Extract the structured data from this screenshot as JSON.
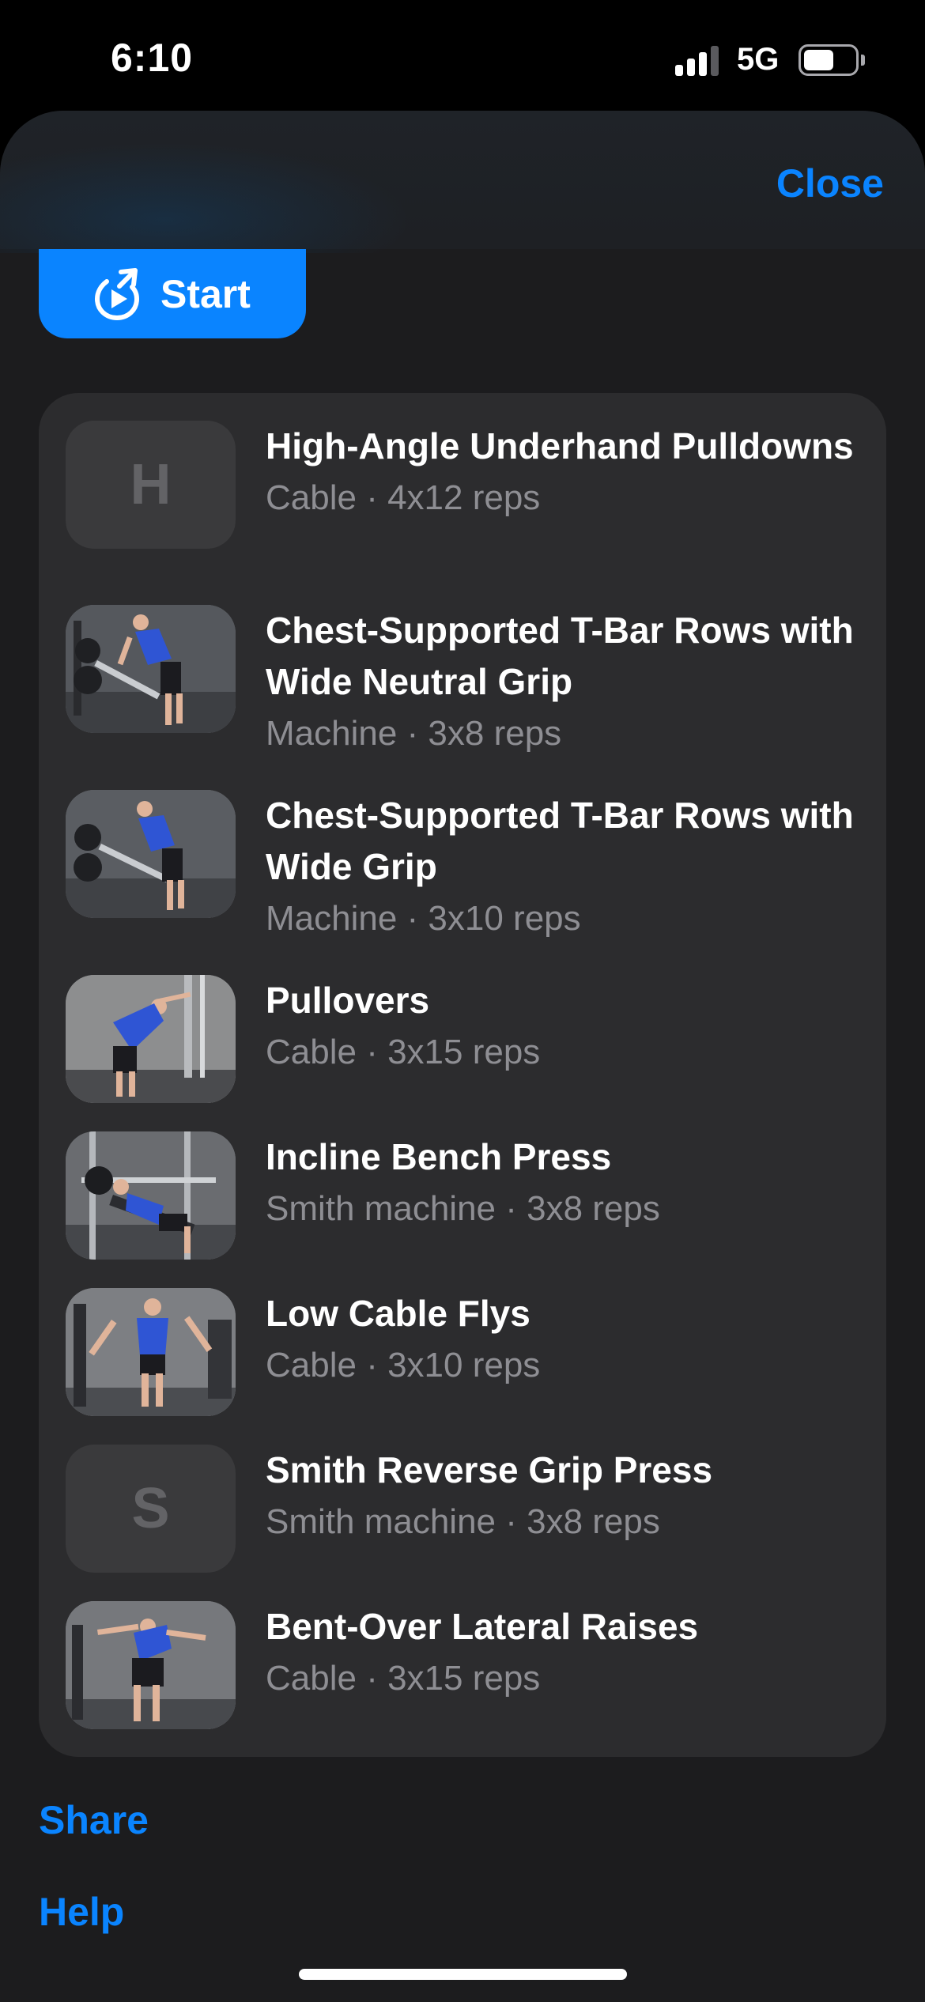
{
  "status_bar": {
    "time": "6:10",
    "network": "5G",
    "signal_bars_active": 3,
    "signal_bars_total": 4,
    "battery_level": 0.6
  },
  "header": {
    "close_label": "Close",
    "start_label": "Start",
    "start_icon": "rocket-play-icon"
  },
  "exercises": [
    {
      "name": "High-Angle Underhand Pulldowns",
      "detail": "Cable · 4x12 reps",
      "thumb_letter": "H"
    },
    {
      "name": "Chest-Supported T-Bar Rows with Wide Neutral Grip",
      "detail": "Machine · 3x8 reps"
    },
    {
      "name": "Chest-Supported T-Bar Rows with Wide Grip",
      "detail": "Machine · 3x10 reps"
    },
    {
      "name": "Pullovers",
      "detail": "Cable · 3x15 reps"
    },
    {
      "name": "Incline Bench Press",
      "detail": "Smith machine · 3x8 reps"
    },
    {
      "name": "Low Cable Flys",
      "detail": "Cable · 3x10 reps"
    },
    {
      "name": "Smith Reverse Grip Press",
      "detail": "Smith machine · 3x8 reps",
      "thumb_letter": "S"
    },
    {
      "name": "Bent-Over Lateral Raises",
      "detail": "Cable · 3x15 reps"
    }
  ],
  "footer": {
    "share_label": "Share",
    "help_label": "Help"
  },
  "colors": {
    "accent": "#0a84ff",
    "sheet_background": "#1c1c1e",
    "card_background": "#2c2c2e",
    "secondary_text": "#8e8e93"
  }
}
